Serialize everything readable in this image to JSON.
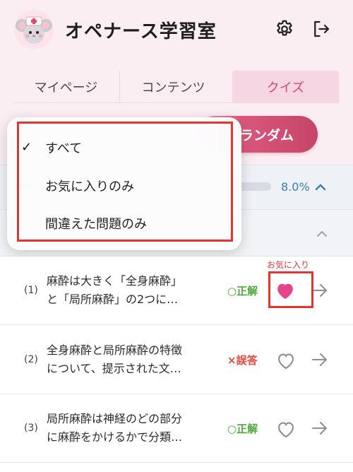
{
  "header": {
    "app_title": "オペナース学習室",
    "avatar_icon": "nurse-mouse-avatar",
    "settings_icon": "gear-icon",
    "logout_icon": "logout-icon"
  },
  "tabs": [
    {
      "label": "マイページ",
      "active": false
    },
    {
      "label": "コンテンツ",
      "active": false
    },
    {
      "label": "クイズ",
      "active": true
    }
  ],
  "random_button": {
    "label": "ランダム"
  },
  "progress": {
    "percent_text": "8.0%",
    "value": 0.08
  },
  "filter_dropdown": {
    "options": [
      {
        "label": "すべて",
        "selected": true
      },
      {
        "label": "お気に入りのみ",
        "selected": false
      },
      {
        "label": "間違えた問題のみ",
        "selected": false
      }
    ],
    "check_mark": "✓"
  },
  "annotation": {
    "favorite_label": "お気に入り"
  },
  "questions": [
    {
      "num": "(1)",
      "line1": "麻酔は大きく「全身麻酔」",
      "line2": "と「局所麻酔」の2つに…",
      "status": "○正解",
      "favorite": true
    },
    {
      "num": "(2)",
      "line1": "全身麻酔と局所麻酔の特徴",
      "line2": "について、提示された文…",
      "status": "×誤答",
      "favorite": false
    },
    {
      "num": "(3)",
      "line1": "局所麻酔は神経のどの部分",
      "line2": "に麻酔をかけるかで分類…",
      "status": "○正解",
      "favorite": false
    }
  ],
  "colors": {
    "accent_pink": "#d1477a",
    "heart_fill": "#e5468a",
    "correct": "#4ea83a",
    "wrong": "#e04a3c",
    "highlight_box": "#e0362c"
  }
}
